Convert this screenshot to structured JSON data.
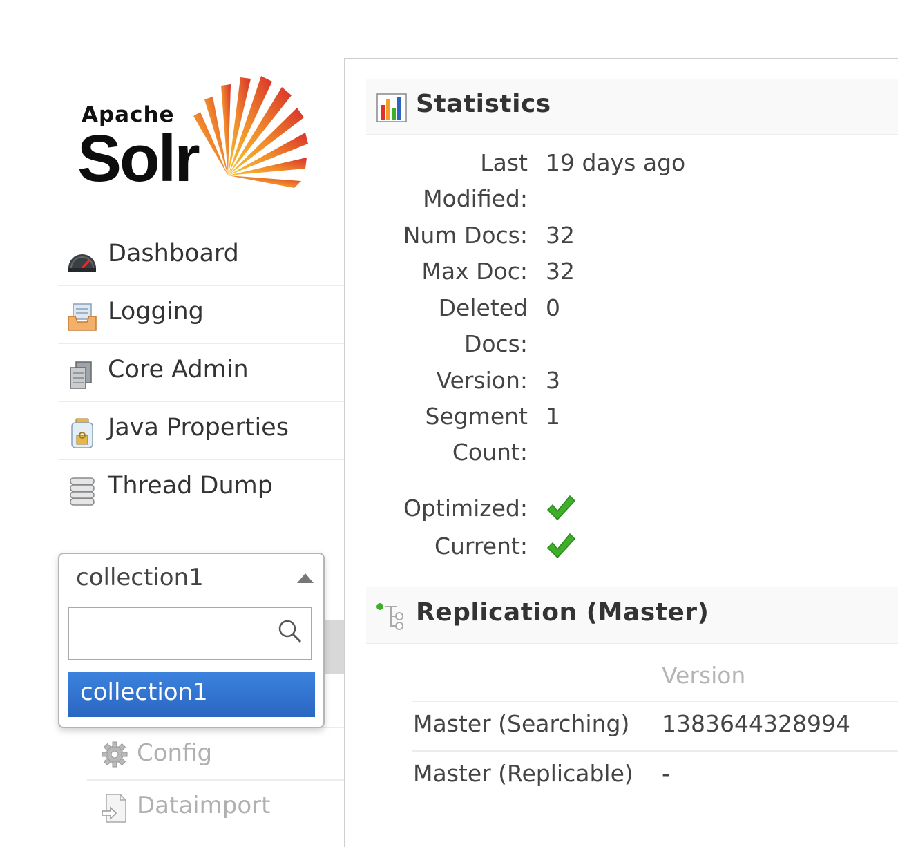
{
  "logo": {
    "apache": "Apache",
    "solr": "Solr"
  },
  "nav": {
    "items": [
      {
        "label": "Dashboard",
        "icon": "dashboard-gauge-icon"
      },
      {
        "label": "Logging",
        "icon": "logging-inbox-icon"
      },
      {
        "label": "Core Admin",
        "icon": "core-admin-stack-icon"
      },
      {
        "label": "Java Properties",
        "icon": "java-jar-icon"
      },
      {
        "label": "Thread Dump",
        "icon": "thread-dump-icon"
      }
    ]
  },
  "core_selector": {
    "selected": "collection1",
    "search_placeholder": "",
    "options": [
      "collection1"
    ]
  },
  "core_menu": {
    "items": [
      {
        "label": "Config",
        "icon": "gear-icon"
      },
      {
        "label": "Dataimport",
        "icon": "dataimport-icon"
      }
    ]
  },
  "statistics": {
    "title": "Statistics",
    "rows": [
      {
        "key1": "Last",
        "key2": "Modified:",
        "value": "19 days ago"
      },
      {
        "key1": "Num Docs:",
        "value": "32"
      },
      {
        "key1": "Max Doc:",
        "value": "32"
      },
      {
        "key1": "Deleted",
        "key2": "Docs:",
        "value": "0"
      },
      {
        "key1": "Version:",
        "value": "3"
      },
      {
        "key1": "Segment",
        "key2": "Count:",
        "value": "1"
      }
    ],
    "flags": [
      {
        "key": "Optimized:",
        "checked": true
      },
      {
        "key": "Current:",
        "checked": true
      }
    ]
  },
  "replication": {
    "title": "Replication (Master)",
    "column_version": "Version",
    "rows": [
      {
        "label": "Master (Searching)",
        "version": "1383644328994"
      },
      {
        "label": "Master (Replicable)",
        "version": "-"
      }
    ]
  },
  "colors": {
    "accent_blue": "#2a66c2",
    "check_green": "#3fae2a",
    "sun_orange": "#e8522a"
  }
}
